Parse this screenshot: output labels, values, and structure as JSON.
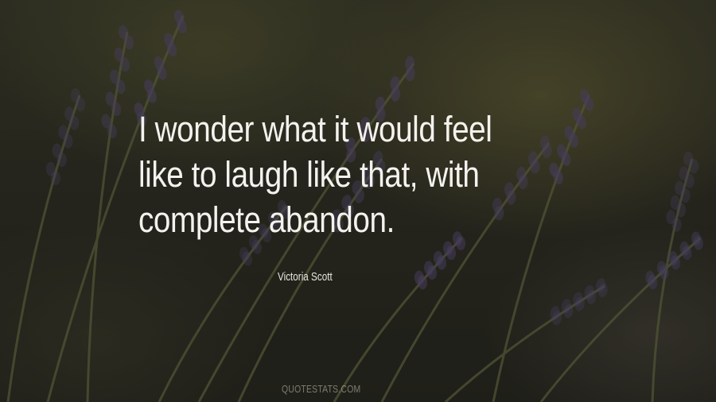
{
  "quote": {
    "lines": [
      "I wonder what it would feel",
      "like to laugh like that, with",
      "complete abandon."
    ]
  },
  "author": "Victoria Scott",
  "watermark": "QUOTESTATS.COM",
  "colors": {
    "text": "#f4f2ee",
    "flowers": "#5b4f7a",
    "stems": "#6b6f45"
  },
  "background": {
    "subject": "lavender-flowers"
  }
}
